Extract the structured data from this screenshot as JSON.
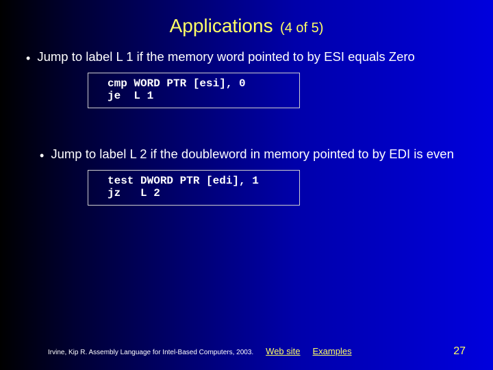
{
  "title": {
    "main": "Applications",
    "sub": "(4 of 5)"
  },
  "bullets": [
    "Jump to label L 1 if the memory word pointed to by ESI equals Zero",
    "Jump to label L 2 if the doubleword in memory pointed to by EDI is even"
  ],
  "code": [
    "cmp WORD PTR [esi], 0\nje  L 1",
    "test DWORD PTR [edi], 1\njz   L 2"
  ],
  "footer": {
    "citation": "Irvine, Kip R. Assembly Language for Intel-Based Computers, 2003.",
    "link1": "Web site",
    "link2": "Examples",
    "page": "27"
  }
}
